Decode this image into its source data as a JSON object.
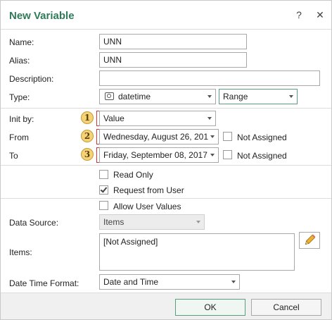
{
  "dialog": {
    "title": "New Variable",
    "help_icon": "question-mark-icon",
    "close_icon": "close-icon"
  },
  "fields": {
    "name_label": "Name:",
    "name_value": "UNN",
    "alias_label": "Alias:",
    "alias_value": "UNN",
    "description_label": "Description:",
    "description_value": "",
    "type_label": "Type:",
    "type_value": "datetime",
    "type_icon": "calendar-clock-icon",
    "type_mode_value": "Range"
  },
  "range": {
    "init_label": "Init by:",
    "init_value": "Value",
    "from_label": "From",
    "from_value": "Wednesday, August 26, 201",
    "to_label": "To",
    "to_value": "Friday, September 08, 2017",
    "not_assigned_label": "Not Assigned",
    "markers": [
      "1",
      "2",
      "3"
    ]
  },
  "options": {
    "read_only": {
      "label": "Read Only",
      "checked": false
    },
    "request_from_user": {
      "label": "Request from User",
      "checked": true
    },
    "allow_user_values": {
      "label": "Allow User Values",
      "checked": false
    }
  },
  "source": {
    "data_source_label": "Data Source:",
    "data_source_value": "Items",
    "items_label": "Items:",
    "items_value": "[Not Assigned]",
    "edit_icon": "pencil-icon"
  },
  "format": {
    "label": "Date Time Format:",
    "value": "Date and Time"
  },
  "buttons": {
    "ok": "OK",
    "cancel": "Cancel"
  },
  "colors": {
    "title": "#2f7a5a",
    "marker_fill": "#f4d27a",
    "bracket": "#dd3333"
  }
}
